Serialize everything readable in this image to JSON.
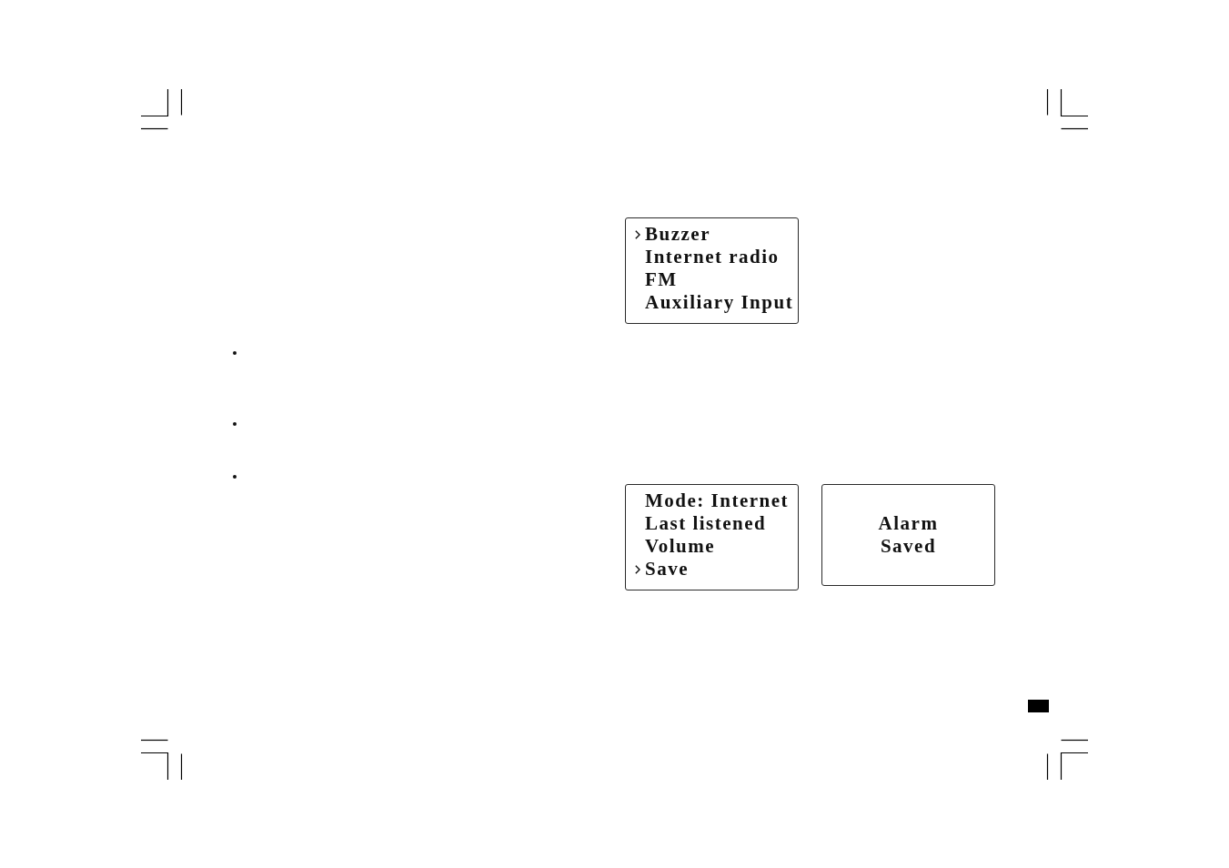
{
  "displays": [
    {
      "kind": "menu",
      "lines": [
        {
          "text": "Buzzer",
          "selected": true
        },
        {
          "text": "Internet radio",
          "selected": false
        },
        {
          "text": "FM",
          "selected": false
        },
        {
          "text": "Auxiliary Input",
          "selected": false
        }
      ]
    },
    {
      "kind": "menu",
      "lines": [
        {
          "text": "Mode: Internet",
          "selected": false
        },
        {
          "text": "Last listened",
          "selected": false
        },
        {
          "text": "Volume",
          "selected": false
        },
        {
          "text": "Save",
          "selected": true
        }
      ]
    },
    {
      "kind": "message",
      "lines": [
        {
          "text": "Alarm"
        },
        {
          "text": "Saved"
        }
      ]
    }
  ]
}
